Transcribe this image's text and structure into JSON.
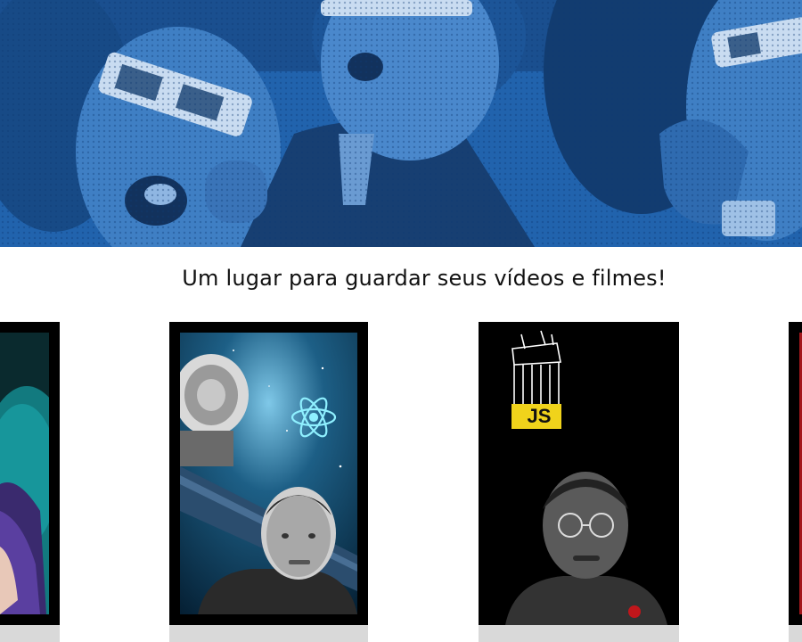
{
  "hero": {
    "image": "audience-3d-glasses-photo"
  },
  "section": {
    "tagline": "Um lugar para guardar seus vídeos e filmes!"
  },
  "carousel": {
    "cards": [
      {
        "name": "video-card-1",
        "thumbnail": "woman-purple-hair-teal-background"
      },
      {
        "name": "video-card-2",
        "thumbnail": "react-satellite-space-man"
      },
      {
        "name": "video-card-3",
        "thumbnail": "javascript-logo-man-glasses"
      },
      {
        "name": "video-card-4",
        "thumbnail": "red-thumbnail-partial"
      }
    ],
    "js_badge": "JS"
  },
  "colors": {
    "hero_tint": "#1f5fa8",
    "card_border": "#000000",
    "card_footer": "#d9d9d9",
    "js_yellow": "#f0d31b"
  }
}
